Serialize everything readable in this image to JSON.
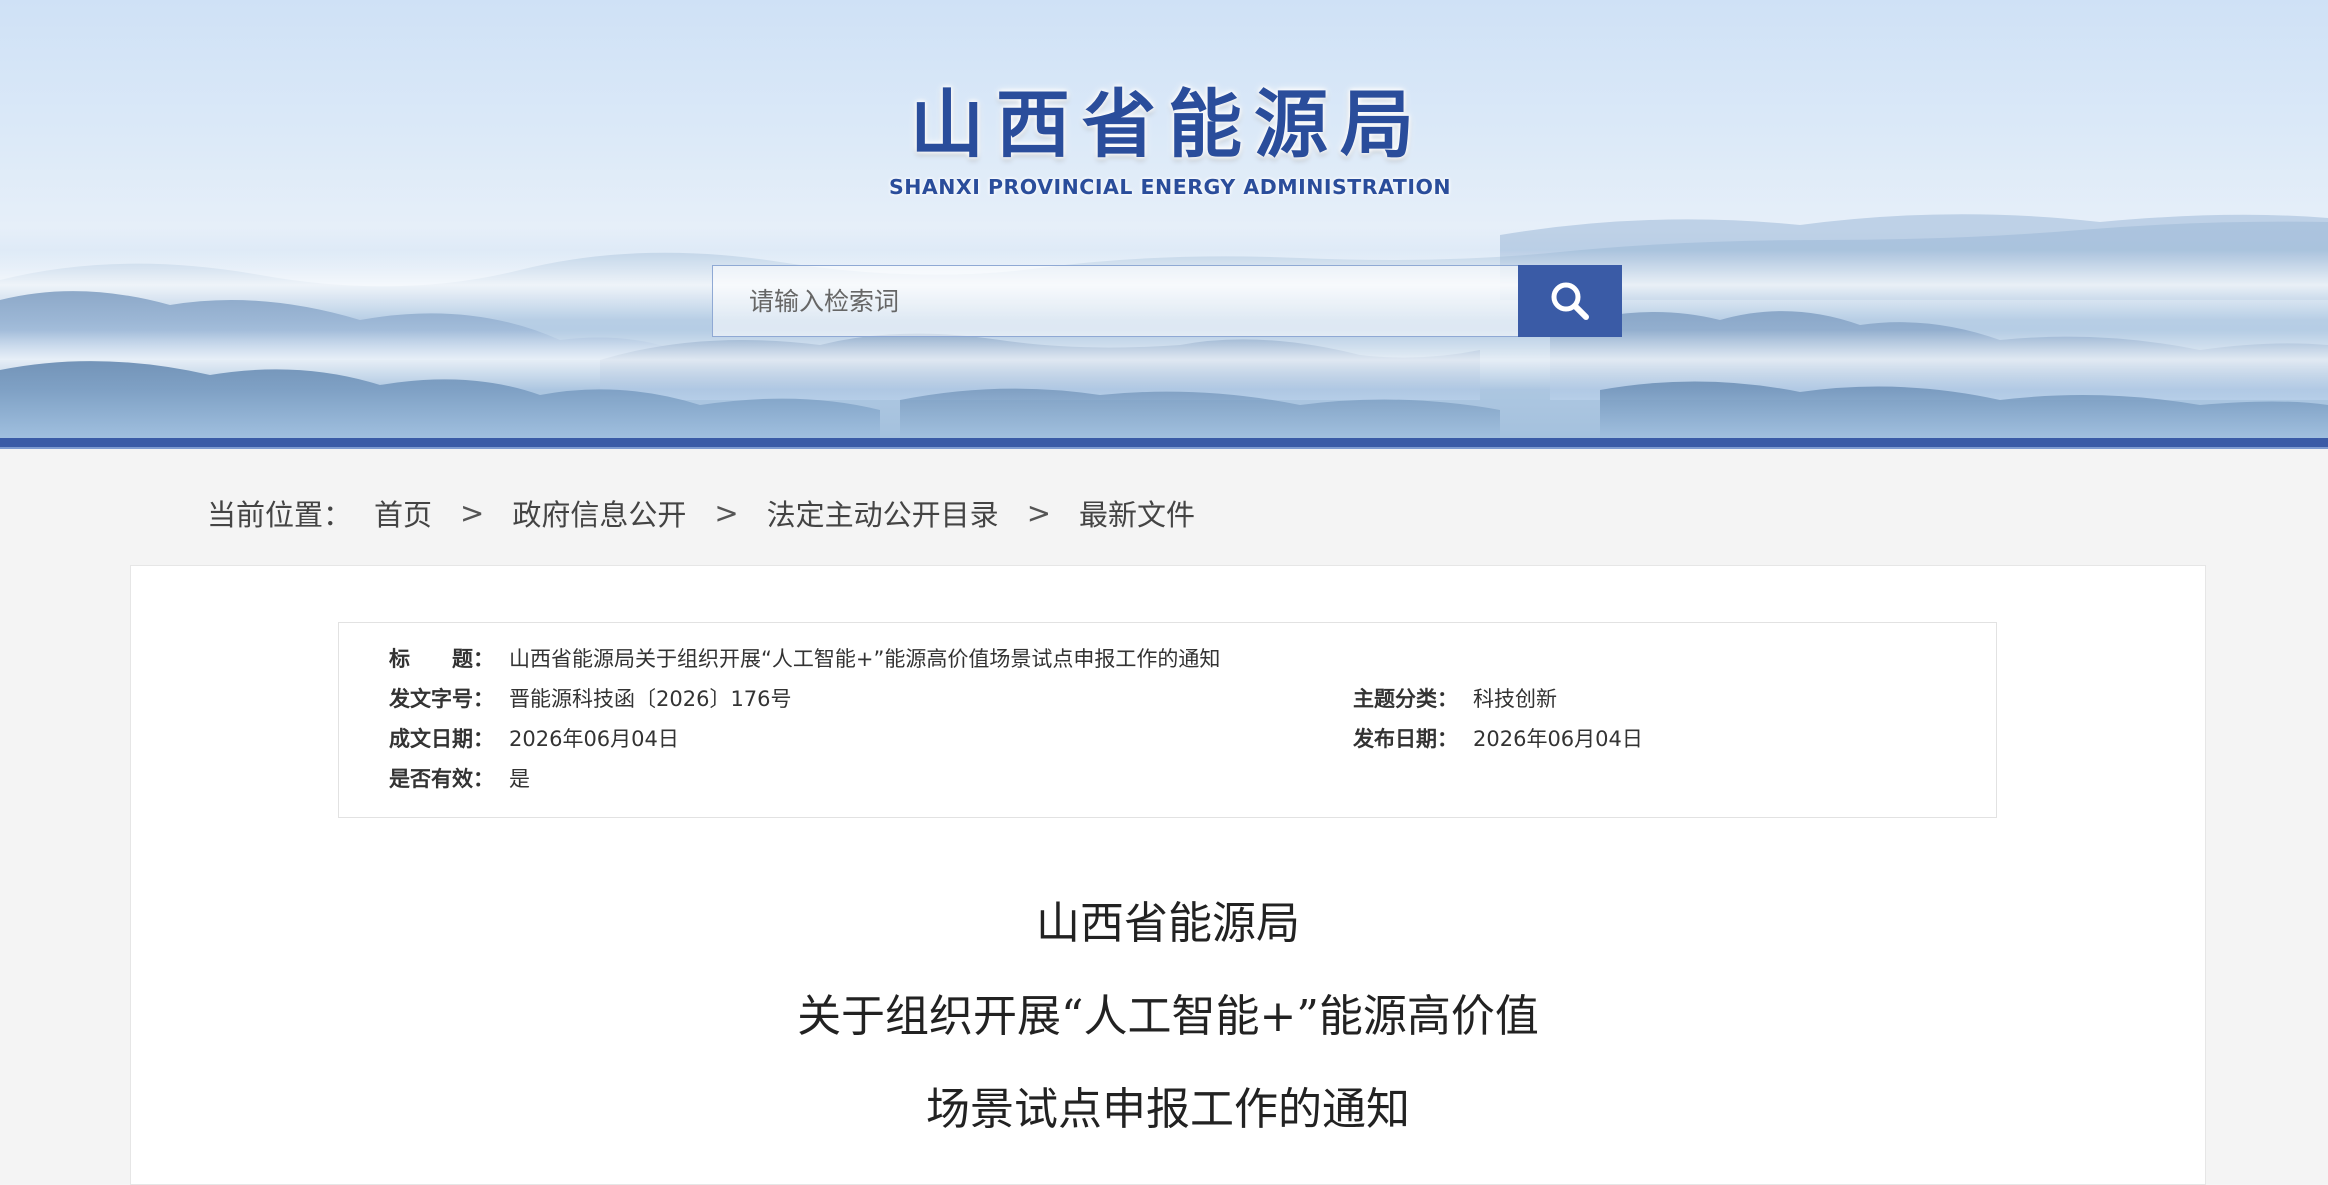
{
  "header": {
    "logo_cn": "山西省能源局",
    "logo_en": "SHANXI  PROVINCIAL  ENERGY ADMINISTRATION",
    "search": {
      "placeholder": "请输入检索词",
      "value": ""
    },
    "search_icon": "search-icon",
    "accent_color": "#3a5ba6"
  },
  "breadcrumb": {
    "label": "当前位置：",
    "items": [
      "首页",
      "政府信息公开",
      "法定主动公开目录",
      "最新文件"
    ],
    "separator": ">"
  },
  "meta": {
    "title_label": "标　　题：",
    "title_value": "山西省能源局关于组织开展“人工智能+”能源高价值场景试点申报工作的通知",
    "doc_no_label": "发文字号：",
    "doc_no_value": "晋能源科技函〔2026〕176号",
    "topic_label": "主题分类：",
    "topic_value": "科技创新",
    "created_label": "成文日期：",
    "created_value": "2026年06月04日",
    "published_label": "发布日期：",
    "published_value": "2026年06月04日",
    "valid_label": "是否有效：",
    "valid_value": "是"
  },
  "document": {
    "title_lines": [
      "山西省能源局",
      "关于组织开展“人工智能+”能源高价值",
      "场景试点申报工作的通知"
    ]
  }
}
